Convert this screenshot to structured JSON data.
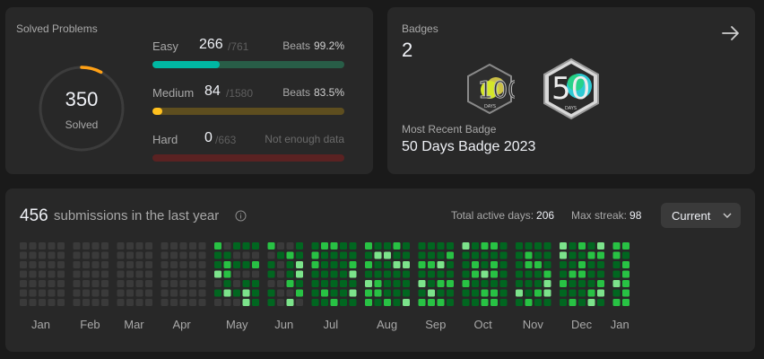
{
  "solved": {
    "title": "Solved Problems",
    "count": "350",
    "count_label": "Solved",
    "progress_fraction": 0.078,
    "difficulties": [
      {
        "name": "Easy",
        "count": "266",
        "total": "/761",
        "beats_label": "Beats",
        "beats_value": "99.2%",
        "fraction": 0.35,
        "fill": "#00b8a3",
        "track": "#285d47"
      },
      {
        "name": "Medium",
        "count": "84",
        "total": "/1580",
        "beats_label": "Beats",
        "beats_value": "83.5%",
        "fraction": 0.053,
        "fill": "#ffc01e",
        "track": "#5e4e1f"
      },
      {
        "name": "Hard",
        "count": "0",
        "total": "/663",
        "beats_label": "Not enough data",
        "beats_value": "",
        "fraction": 0,
        "fill": "#ef4743",
        "track": "#5a2222"
      }
    ]
  },
  "badges": {
    "title": "Badges",
    "count": "2",
    "recent_label": "Most Recent Badge",
    "recent_name": "50 Days Badge 2023",
    "items": [
      {
        "label": "100",
        "sub": "DAYS",
        "icon": "100-days-badge-icon"
      },
      {
        "label": "50",
        "sub": "DAYS",
        "icon": "50-days-badge-icon"
      }
    ]
  },
  "activity": {
    "count": "456",
    "text": "submissions in the last year",
    "active_days_label": "Total active days:",
    "active_days": "206",
    "max_streak_label": "Max streak:",
    "max_streak": "98",
    "select_value": "Current",
    "months": [
      "Jan",
      "Feb",
      "Mar",
      "Apr",
      "May",
      "Jun",
      "Jul",
      "Aug",
      "Sep",
      "Oct",
      "Nov",
      "Dec",
      "Jan"
    ],
    "weeks": [
      5,
      4,
      4,
      5,
      5,
      4,
      5,
      5,
      4,
      5,
      4,
      5,
      2
    ],
    "colors": {
      "empty": "#3a3a3a",
      "level1": "#016620",
      "level2": "#28c244",
      "level3": "#7ce38b",
      "accent": "#2cbb5d"
    }
  }
}
